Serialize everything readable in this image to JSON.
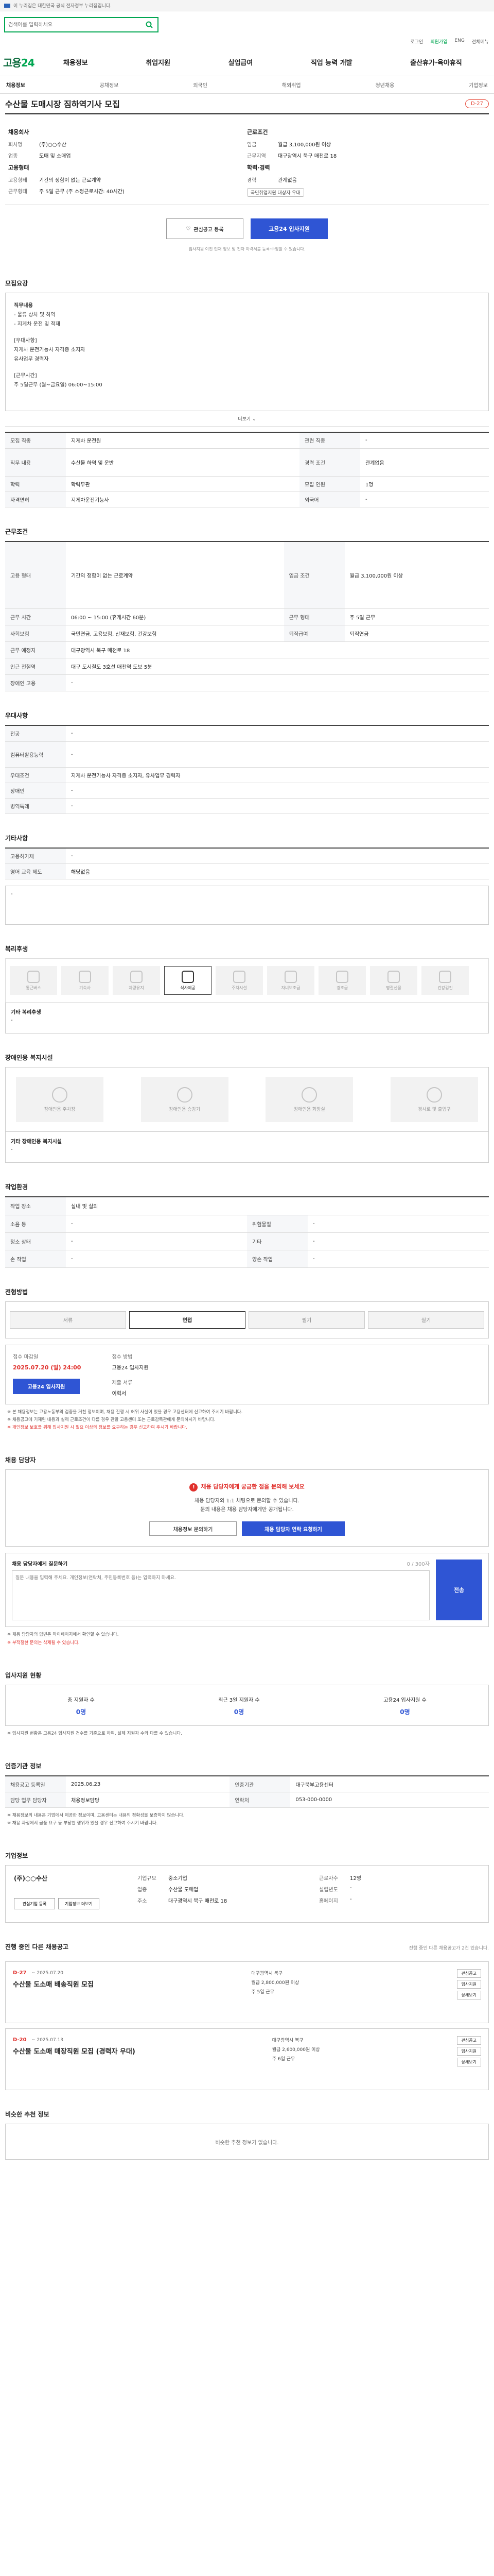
{
  "top_notice": "이 누리집은 대한민국 공식 전자정부 누리집입니다.",
  "search": {
    "placeholder": "검색어를 입력하세요"
  },
  "util": {
    "login": "로그인",
    "join": "회원가입",
    "eng": "ENG",
    "all_menu": "전체메뉴"
  },
  "logo": {
    "main": "고용",
    "num": "24"
  },
  "gnb": [
    "채용정보",
    "취업지원",
    "실업급여",
    "직업 능력 개발",
    "출산휴가·육아휴직"
  ],
  "lnb": [
    "채용정보",
    "공채정보",
    "외국인",
    "해외취업",
    "청년채용",
    "기업정보"
  ],
  "title": "수산물 도매시장 짐하역기사 모집",
  "dday": "D-27",
  "summary": {
    "company_h": "채용회사",
    "company_rows": [
      {
        "k": "회사명",
        "v": "(주)○○수산"
      },
      {
        "k": "업종",
        "v": "도매 및 소매업"
      }
    ],
    "rep_h": "고용형태",
    "rep_rows": [
      {
        "k": "고용형태",
        "v": "기간의 정함이 없는 근로계약"
      },
      {
        "k": "근무형태",
        "v": "주 5일 근무 (주 소정근로시간: 40시간)"
      }
    ],
    "cond_h": "근로조건",
    "cond_rows": [
      {
        "k": "임금",
        "v": "월급 3,100,000원 이상"
      },
      {
        "k": "근무지역",
        "v": "대구광역시 북구 매천로 18"
      }
    ],
    "edu_h": "학력·경력",
    "edu_rows": [
      {
        "k": "경력",
        "v": "관계없음"
      }
    ],
    "chip": "국민취업지원 대상자 우대"
  },
  "actions": {
    "scrap": "관심공고 등록",
    "apply": "고용24 입사지원"
  },
  "action_note": "입사지원 이전 인재 정보 및 전자 이력서를 등록·수정할 수 있습니다.",
  "sections": {
    "recruit": "모집요강",
    "work": "근무조건",
    "qual": "우대사항",
    "etc": "기타사항",
    "welfare": "복리후생",
    "disabled": "장애인용 복지시설",
    "env": "작업환경",
    "method": "전형방법",
    "inquiry": "채용 담당자",
    "status": "입사지원 현황",
    "certify": "인증기관 정보",
    "company": "기업정보",
    "other_jobs": "진행 중인 다른 채용공고",
    "similar": "비슷한 추천 정보"
  },
  "job_desc": {
    "h": "직무내용",
    "lines": [
      "- 물류 상차 및 하역",
      "- 지게차 운전 및 적재",
      "",
      "[우대사항]",
      "지게차 운전기능사 자격증 소지자",
      "유사업무 경력자",
      "",
      "[근무시간]",
      "주 5일근무 (월~금요일) 06:00~15:00"
    ],
    "more": "더보기"
  },
  "recruit_table": [
    {
      "k": "모집 직종",
      "v": "지게차 운전원",
      "k2": "관련 직종",
      "v2": "-"
    },
    {
      "k": "직무 내용",
      "v": "수산물 하역 및 운반",
      "k2": "경력 조건",
      "v2": "관계없음"
    },
    {
      "k": "학력",
      "v": "학력무관",
      "k2": "모집 인원",
      "v2": "1명"
    },
    {
      "k": "자격면허",
      "v": "지게차운전기능사",
      "k2": "외국어",
      "v2": "-"
    }
  ],
  "work_table": [
    {
      "k": "고용 형태",
      "v": "기간의 정함이 없는 근로계약",
      "k2": "임금 조건",
      "v2": "월급 3,100,000원 이상"
    },
    {
      "k": "근무 시간",
      "v": "06:00 ~ 15:00 (휴게시간 60분)",
      "k2": "근무 형태",
      "v2": "주 5일 근무"
    },
    {
      "k": "사회보험",
      "v": "국민연금, 고용보험, 산재보험, 건강보험",
      "k2": "퇴직급여",
      "v2": "퇴직연금"
    },
    {
      "k": "근무 예정지",
      "v": "대구광역시 북구 매천로 18",
      "k2": "",
      "v2": ""
    },
    {
      "k": "인근 전철역",
      "v": "대구 도시철도 3호선 매천역 도보 5분",
      "k2": "",
      "v2": ""
    },
    {
      "k": "장애인 고용",
      "v": "-",
      "k2": "",
      "v2": ""
    }
  ],
  "pref_table": [
    {
      "k": "전공",
      "v": "-"
    },
    {
      "k": "컴퓨터활용능력",
      "v": "-"
    },
    {
      "k": "우대조건",
      "v": "지게차 운전기능사 자격증 소지자, 유사업무 경력자"
    },
    {
      "k": "장애인",
      "v": "-"
    },
    {
      "k": "병역특례",
      "v": "-"
    }
  ],
  "etc_table": [
    {
      "k": "고용허가제",
      "v": "-"
    },
    {
      "k": "영어 교육 제도",
      "v": "해당없음"
    }
  ],
  "welfare_icons": [
    "통근버스",
    "기숙사",
    "차량유지",
    "식사제공",
    "주차시설",
    "자녀보조금",
    "경조금",
    "명절선물",
    "건강검진"
  ],
  "welfare_on": "식사제공",
  "welfare_etc_h": "기타 복리후생",
  "welfare_etc": "-",
  "disabled_icons": [
    "장애인용 주차장",
    "장애인용 승강기",
    "장애인용 화장실",
    "경사로 및 출입구"
  ],
  "disabled_etc_h": "기타 장애인용 복지시설",
  "disabled_etc": "-",
  "env_table": [
    {
      "k": "작업 장소",
      "v": "실내 및 실외",
      "k2": "",
      "v2": ""
    },
    {
      "k": "소음 등",
      "v": "-",
      "k2": "위험물질",
      "v2": "-"
    },
    {
      "k": "청소 상태",
      "v": "-",
      "k2": "기타",
      "v2": "-"
    },
    {
      "k": "손 작업",
      "v": "-",
      "k2": "양손 작업",
      "v2": "-"
    }
  ],
  "method_steps": [
    "서류",
    "면접",
    "필기",
    "실기"
  ],
  "method_step_on": "면접",
  "apply": {
    "deadline_k": "접수 마감일",
    "deadline_v": "2025.07.20 (일) 24:00",
    "method_k": "접수 방법",
    "method_v": "고용24 입사지원",
    "doc_k": "제출 서류",
    "doc_v": "이력서",
    "btn": "고용24 입사지원"
  },
  "method_notes": [
    "※ 본 채용정보는 고용노동부의 검증을 거친 정보이며, 채용 진행 시 허위 사실이 있을 경우 고용센터에 신고하여 주시기 바랍니다.",
    "※ 채용공고에 기재된 내용과 실제 근로조건이 다를 경우 관할 고용센터 또는 근로감독관에게 문의하시기 바랍니다.",
    "※ 개인정보 보호를 위해 입사지원 시 필요 이상의 정보를 요구하는 경우 신고하여 주시기 바랍니다."
  ],
  "inquiry_alert": {
    "title": "채용 담당자에게 궁금한 점을 문의해 보세요",
    "lines": [
      "채용 담당자와 1:1 채팅으로 문의할 수 있습니다.",
      "문의 내용은 채용 담당자에게만 공개됩니다."
    ]
  },
  "inquiry_buttons": {
    "left": "채용정보 문의하기",
    "right": "채용 담당자 연락 요청하기"
  },
  "inquiry_box": {
    "label": "채용 담당자에게 질문하기",
    "limit": "0 / 300자",
    "placeholder": "질문 내용을 입력해 주세요. 개인정보(연락처, 주민등록번호 등)는 입력하지 마세요.",
    "btn": "전송"
  },
  "inquiry_notes": [
    "※ 채용 담당자의 답변은 마이페이지에서 확인할 수 있습니다.",
    "※ 부적절한 문의는 삭제될 수 있습니다."
  ],
  "status": [
    {
      "label": "총 지원자 수",
      "n": "0명"
    },
    {
      "label": "최근 3일 지원자 수",
      "n": "0명"
    },
    {
      "label": "고용24 입사지원 수",
      "n": "0명"
    }
  ],
  "status_note": "※ 입사지원 현황은 고용24 입사지원 건수를 기준으로 하며, 실제 지원자 수와 다를 수 있습니다.",
  "certify_table": [
    {
      "k": "채용공고 등록일",
      "v": "2025.06.23",
      "k2": "인증기관",
      "v2": "대구북부고용센터"
    },
    {
      "k": "담당 업무 담당자",
      "v": "채용정보담당",
      "k2": "연락처",
      "v2": "053-000-0000"
    }
  ],
  "certify_notes": [
    "※ 채용정보의 내용은 기업에서 제공한 정보이며, 고용센터는 내용의 정확성을 보증하지 않습니다.",
    "※ 채용 과정에서 금품 요구 등 부당한 행위가 있을 경우 신고하여 주시기 바랍니다."
  ],
  "company_info": {
    "name": "(주)○○수산",
    "rows": [
      {
        "k": "기업규모",
        "v": "중소기업"
      },
      {
        "k": "업종",
        "v": "수산물 도매업"
      },
      {
        "k": "주소",
        "v": "대구광역시 북구 매천로 18"
      }
    ],
    "rows2": [
      {
        "k": "근로자수",
        "v": "12명"
      },
      {
        "k": "설립년도",
        "v": "-"
      },
      {
        "k": "홈페이지",
        "v": "-"
      }
    ],
    "btn1": "관심기업 등록",
    "btn2": "기업정보 더보기"
  },
  "other_jobs_note": "진행 중인 다른 채용공고가 2건 있습니다.",
  "jobs": [
    {
      "dday": "D-27",
      "date": "~ 2025.07.20",
      "title": "수산물 도소매 배송직원 모집",
      "meta": [
        "대구광역시 북구",
        "월급 2,800,000원 이상",
        "주 5일 근무"
      ]
    },
    {
      "dday": "D-20",
      "date": "~ 2025.07.13",
      "title": "수산물 도소매 매장직원 모집 (경력자 우대)",
      "meta": [
        "대구광역시 북구",
        "월급 2,600,000원 이상",
        "주 6일 근무"
      ]
    }
  ],
  "job_buttons": [
    "관심공고",
    "입사지원",
    "상세보기"
  ],
  "similar_empty": "비슷한 추천 정보가 없습니다."
}
